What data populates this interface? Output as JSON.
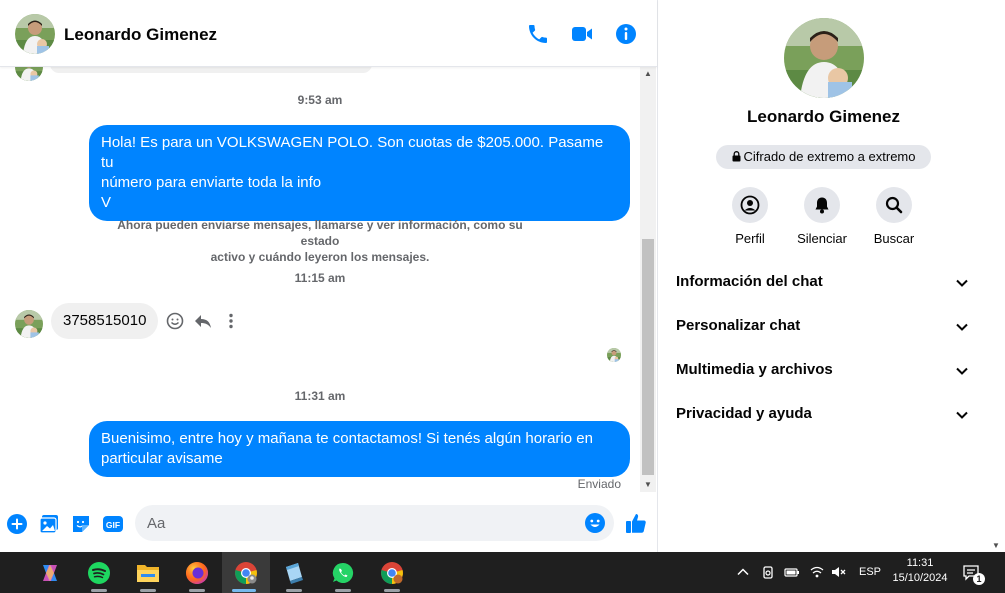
{
  "contact": {
    "name": "Leonardo Gimenez"
  },
  "header": {
    "call_icon": "phone-icon",
    "video_icon": "video-camera-icon",
    "info_icon": "info-icon"
  },
  "messages": {
    "time1": "9:53 am",
    "out1_line1": "Hola! Es para un VOLKSWAGEN POLO. Son cuotas de $205.000. Pasame tu",
    "out1_line2": "número para enviarte toda la info",
    "out1_line3": "V",
    "system_line1": "Ahora pueden enviarse mensajes, llamarse y ver información, como su estado",
    "system_line2": "activo y cuándo leyeron los mensajes.",
    "time2": "11:15 am",
    "in1": "3758515010",
    "time3": "11:31 am",
    "out2_line1": "Buenisimo, entre hoy y mañana te contactamos! Si tenés algún horario en",
    "out2_line2": "particular avisame",
    "status": "Enviado"
  },
  "composer": {
    "placeholder": "Aa"
  },
  "panel": {
    "e2e_label": "Cifrado de extremo a extremo",
    "actions": [
      {
        "label": "Perfil",
        "icon": "profile-icon"
      },
      {
        "label": "Silenciar",
        "icon": "bell-icon"
      },
      {
        "label": "Buscar",
        "icon": "search-icon"
      }
    ],
    "sections": [
      {
        "label": "Información del chat"
      },
      {
        "label": "Personalizar chat"
      },
      {
        "label": "Multimedia y archivos"
      },
      {
        "label": "Privacidad y ayuda"
      }
    ]
  },
  "taskbar": {
    "lang": "ESP",
    "time": "11:31",
    "date": "15/10/2024",
    "notifications": "1"
  },
  "colors": {
    "accent": "#0084ff",
    "incoming_bubble": "#f0f0f0",
    "taskbar": "#1f1f1f"
  }
}
